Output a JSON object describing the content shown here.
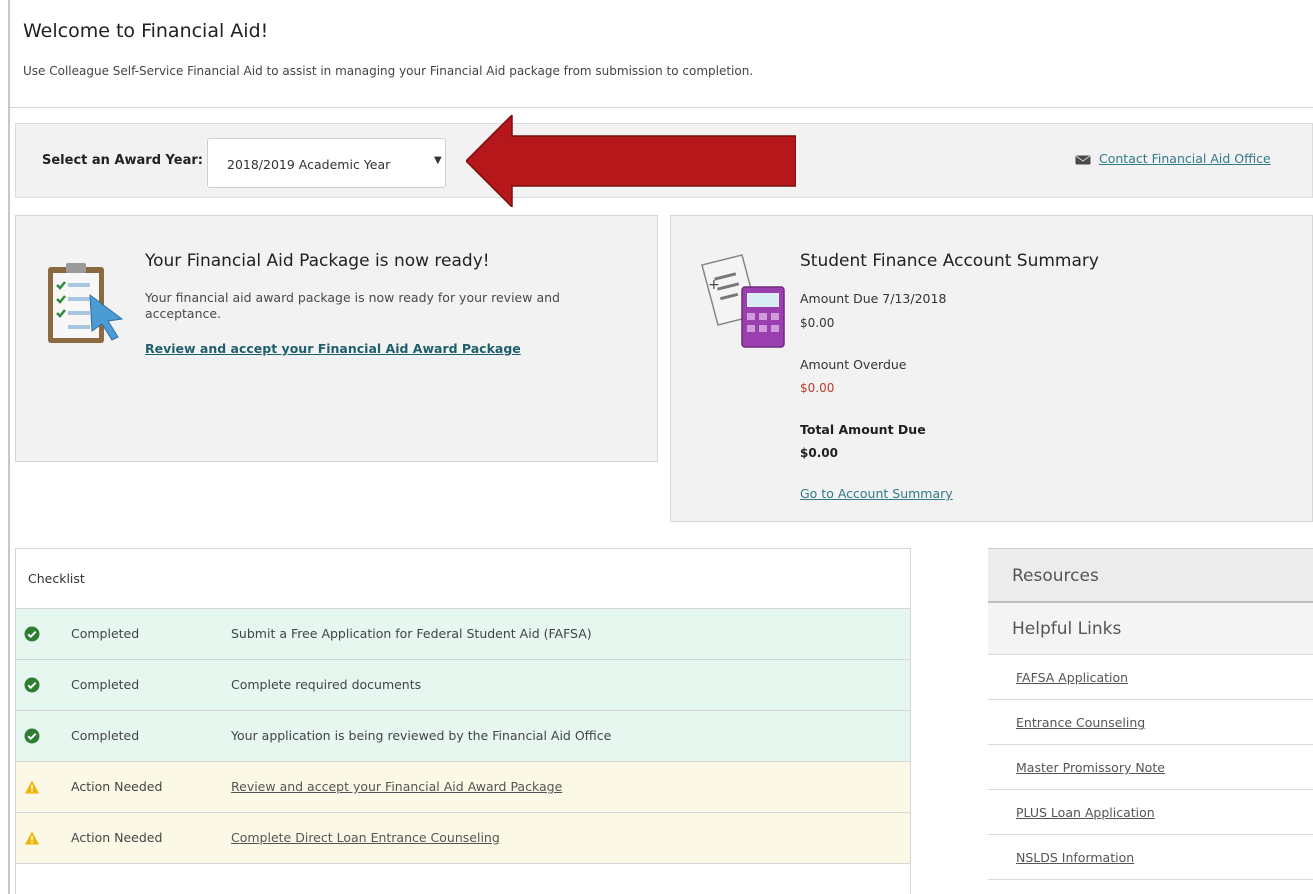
{
  "header": {
    "title": "Welcome to Financial Aid!",
    "description": "Use Colleague Self-Service Financial Aid to assist in managing your Financial Aid package from submission to completion."
  },
  "award_year": {
    "label": "Select an Award Year:",
    "selected": "2018/2019 Academic Year",
    "caret": "▼"
  },
  "contact": {
    "icon": "envelope-icon",
    "label": "Contact Financial Aid Office"
  },
  "package_panel": {
    "icon": "clipboard-checklist-icon",
    "title": "Your Financial Aid Package is now ready!",
    "text": "Your financial aid award package is now ready for your review and acceptance.",
    "link": "Review and accept your Financial Aid Award Package"
  },
  "finance_panel": {
    "icon": "bill-calculator-icon",
    "title": "Student Finance Account Summary",
    "amount_due_label": "Amount Due 7/13/2018",
    "amount_due_value": "$0.00",
    "overdue_label": "Amount Overdue",
    "overdue_value": "$0.00",
    "total_label": "Total Amount Due",
    "total_value": "$0.00",
    "link": "Go to Account Summary"
  },
  "checklist": {
    "title": "Checklist",
    "rows": [
      {
        "status": "Completed",
        "task": "Submit a Free Application for Federal Student Aid (FAFSA)",
        "state": "done"
      },
      {
        "status": "Completed",
        "task": "Complete required documents",
        "state": "done"
      },
      {
        "status": "Completed",
        "task": "Your application is being reviewed by the Financial Aid Office",
        "state": "done"
      },
      {
        "status": "Action Needed",
        "task": "Review and accept your Financial Aid Award Package",
        "state": "todo"
      },
      {
        "status": "Action Needed",
        "task": "Complete Direct Loan Entrance Counseling",
        "state": "todo"
      }
    ]
  },
  "resources": {
    "title": "Resources",
    "helpful_links_title": "Helpful Links",
    "links": [
      "FAFSA Application",
      "Entrance Counseling",
      "Master Promissory Note",
      "PLUS Loan Application",
      "NSLDS Information"
    ]
  },
  "colors": {
    "link": "#337a8a",
    "completed_bg": "#e5f7ef",
    "action_bg": "#fbf9e6",
    "check_green": "#2e7d32",
    "warning_yellow": "#f2b705",
    "arrow_red": "#b5171b",
    "overdue_red": "#c0392b"
  }
}
